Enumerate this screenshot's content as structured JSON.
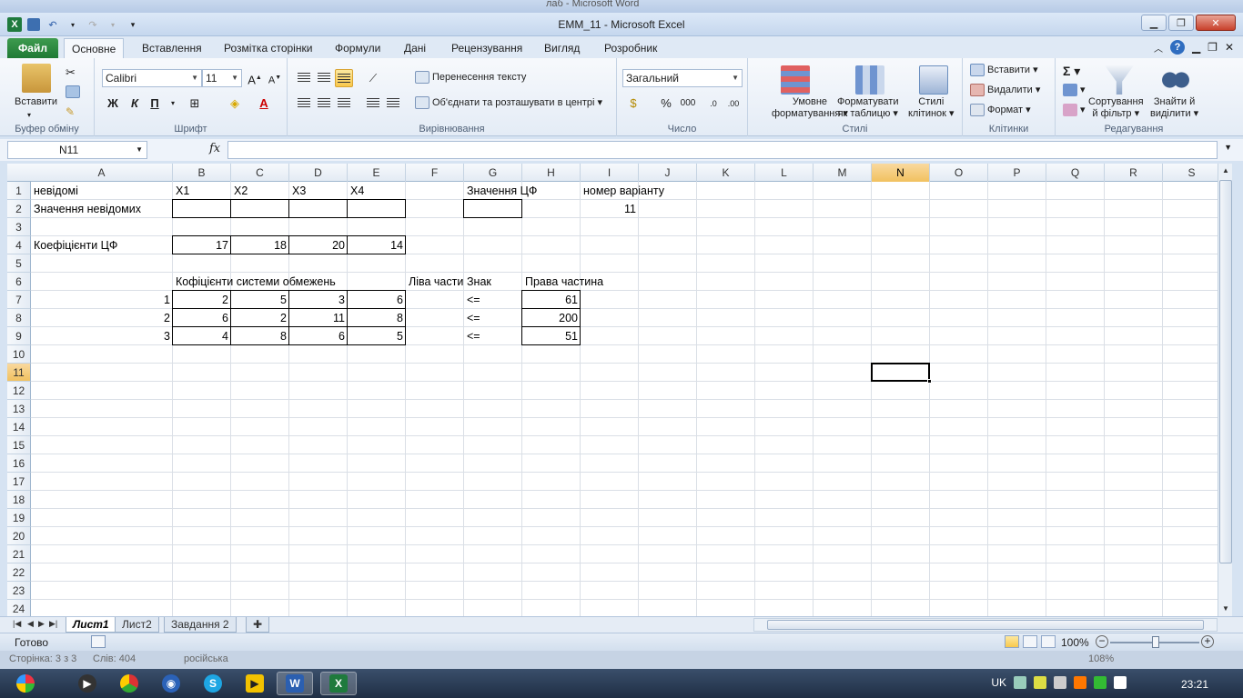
{
  "background_window": {
    "title": "лаб - Microsoft Word",
    "status_left": "Сторінка: 3 з 3",
    "words": "Слів: 404",
    "language": "російська",
    "zoom": "108%"
  },
  "window": {
    "title": "EMM_11  -  Microsoft Excel"
  },
  "ribbon_tabs": [
    "Файл",
    "Основне",
    "Вставлення",
    "Розмітка сторінки",
    "Формули",
    "Дані",
    "Рецензування",
    "Вигляд",
    "Розробник"
  ],
  "active_tab": "Основне",
  "ribbon": {
    "clipboard": {
      "label": "Буфер обміну",
      "paste": "Вставити"
    },
    "font": {
      "label": "Шрифт",
      "name": "Calibri",
      "size": "11",
      "bold": "Ж",
      "italic": "К",
      "underline": "П"
    },
    "alignment": {
      "label": "Вирівнювання",
      "wrap": "Перенесення тексту",
      "merge": "Об'єднати та розташувати в центрі"
    },
    "number": {
      "label": "Число",
      "format": "Загальний",
      "percent": "%",
      "thousands": "000"
    },
    "styles": {
      "label": "Стилі",
      "conditional": "Умовне\nформатування",
      "cond_line1": "Умовне",
      "cond_line2": "форматування",
      "table_line1": "Форматувати",
      "table_line2": "як таблицю",
      "cell_line1": "Стилі",
      "cell_line2": "клітинок"
    },
    "cells": {
      "label": "Клітинки",
      "insert": "Вставити",
      "delete": "Видалити",
      "format": "Формат"
    },
    "editing": {
      "label": "Редагування",
      "sort_line1": "Сортування",
      "sort_line2": "й фільтр",
      "find_line1": "Знайти й",
      "find_line2": "виділити"
    }
  },
  "formula_bar": {
    "name_box": "N11",
    "fx": "fx",
    "formula": ""
  },
  "columns": [
    "A",
    "B",
    "C",
    "D",
    "E",
    "F",
    "G",
    "H",
    "I",
    "J",
    "K",
    "L",
    "M",
    "N",
    "O",
    "P",
    "Q",
    "R",
    "S"
  ],
  "selected_column": "N",
  "rows": [
    "1",
    "2",
    "3",
    "4",
    "5",
    "6",
    "7",
    "8",
    "9",
    "10",
    "11",
    "12",
    "13",
    "14",
    "15",
    "16",
    "17",
    "18",
    "19",
    "20",
    "21",
    "22",
    "23",
    "24"
  ],
  "selected_row": "11",
  "cells": {
    "A1": "невідомі",
    "B1": "X1",
    "C1": "X2",
    "D1": "X3",
    "E1": "X4",
    "G1": "Значення ЦФ",
    "I1": "номер варіанту",
    "A2": "Значення невідомих",
    "I2": "11",
    "A4": "Коефіцієнти ЦФ",
    "B4": "17",
    "C4": "18",
    "D4": "20",
    "E4": "14",
    "B6": "Кофіцієнти системи обмежень",
    "F6": "Ліва части",
    "G6": "Знак",
    "H6": "Права частина",
    "A7": "1",
    "B7": "2",
    "C7": "5",
    "D7": "3",
    "E7": "6",
    "G7": "<=",
    "H7": "61",
    "A8": "2",
    "B8": "6",
    "C8": "2",
    "D8": "11",
    "E8": "8",
    "G8": "<=",
    "H8": "200",
    "A9": "3",
    "B9": "4",
    "C9": "8",
    "D9": "6",
    "E9": "5",
    "G9": "<=",
    "H9": "51"
  },
  "sheets": [
    "Лист1",
    "Лист2",
    "Завдання 2"
  ],
  "active_sheet": "Лист1",
  "status": {
    "ready": "Готово",
    "zoom": "100%"
  },
  "taskbar": {
    "language": "UK",
    "time": "23:21"
  },
  "colors": {
    "excel_green": "#1f7a3d",
    "selection_header": "#f1c15f"
  }
}
